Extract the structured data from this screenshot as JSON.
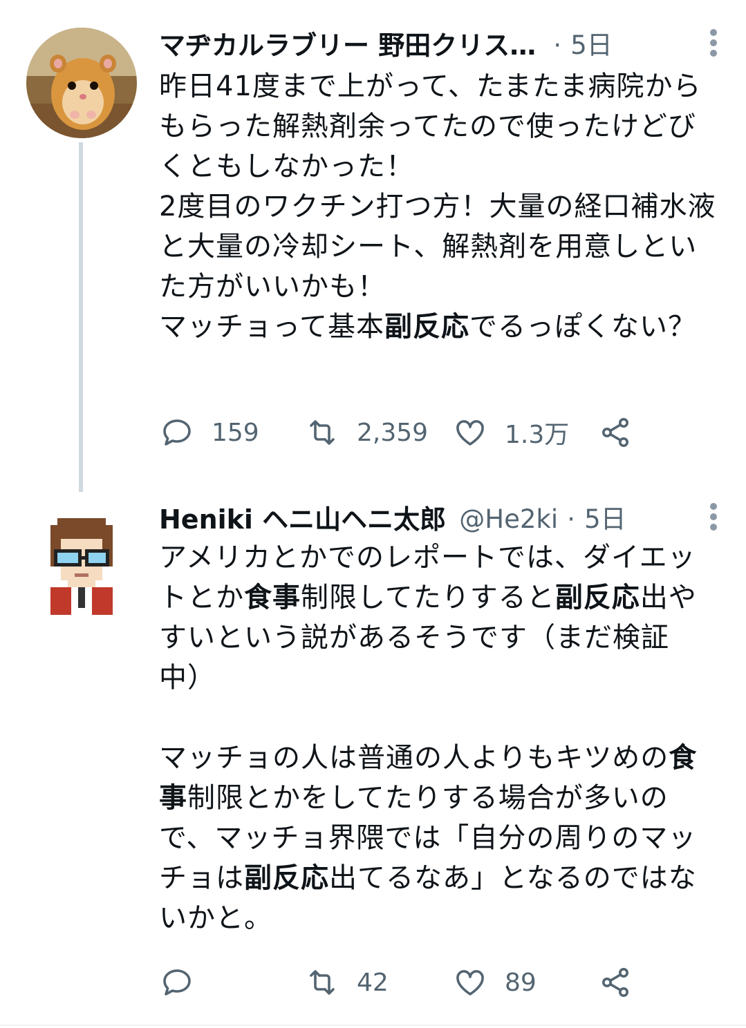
{
  "tweets": [
    {
      "avatar": "hamster-photo-avatar",
      "name": "マヂカルラブリー 野田クリス…",
      "handle": "",
      "separator": "·",
      "time": "5日",
      "body_html": "昨日41度まで上がって、たまたま病院からもらった解熱剤余ってたので使ったけどびくともしなかった！<br>2度目のワクチン打つ方！大量の経口補水液と大量の冷却シート、解熱剤を用意しといた方がいいかも！<br>マッチョって基本<b>副反応</b>でるっぽくない？",
      "stats": {
        "replies": "159",
        "retweets": "2,359",
        "likes": "1.3万"
      }
    },
    {
      "avatar": "pixel-art-avatar",
      "name": "Heniki ヘニ山ヘニ太郎",
      "handle": "@He2ki",
      "separator": "·",
      "time": "5日",
      "body_html": "アメリカとかでのレポートでは、ダイエットとか<b>食事</b>制限してたりすると<b>副反応</b>出やすいという説があるそうです（まだ検証中）<br><br>マッチョの人は普通の人よりもキツめの<b>食事</b>制限とかをしてたりする場合が多いので、マッチョ界隈では「自分の周りのマッチョは<b>副反応</b>出てるなあ」となるのではないかと。",
      "stats": {
        "replies": "",
        "retweets": "42",
        "likes": "89"
      }
    }
  ],
  "icons": [
    "reply-icon",
    "retweet-icon",
    "like-icon",
    "share-icon",
    "more-icon"
  ],
  "colors": {
    "text": "#0f1419",
    "muted": "#536471",
    "thread": "#cfd9de"
  }
}
